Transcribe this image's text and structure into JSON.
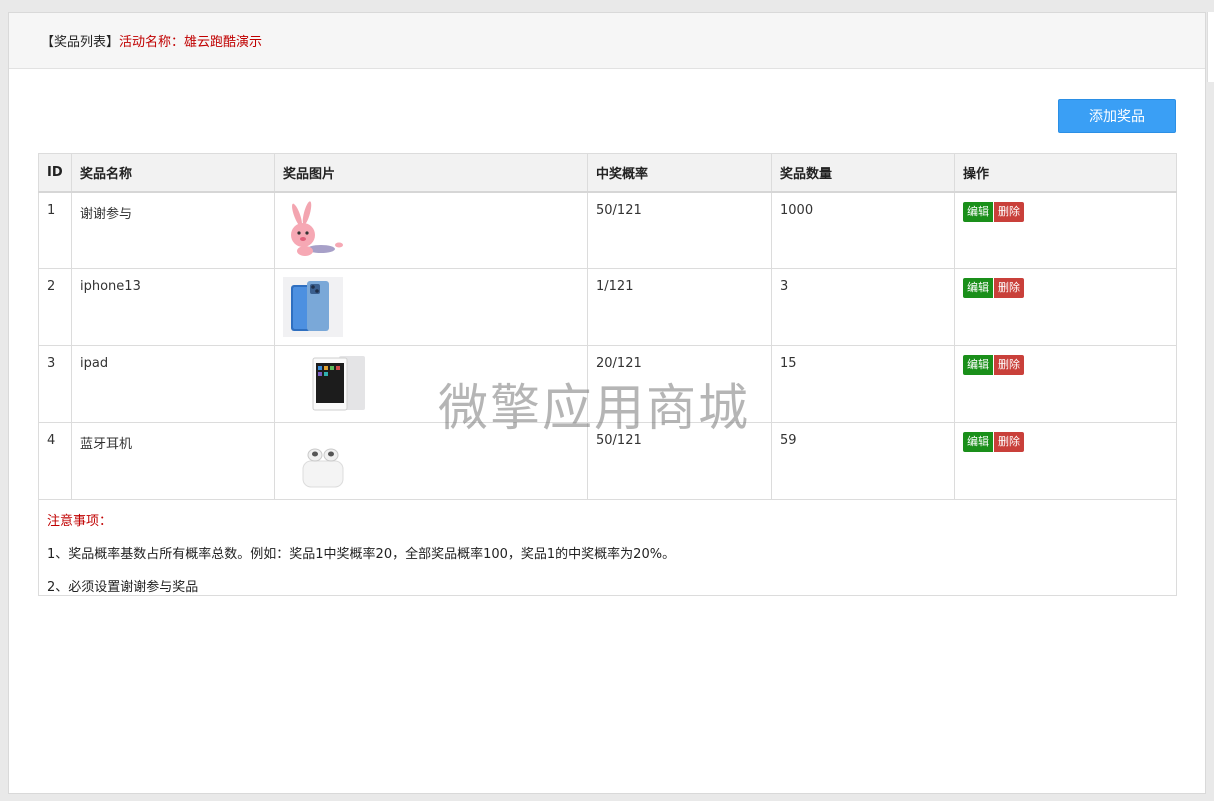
{
  "header": {
    "bracket_title": "【奖品列表】",
    "activity_label": "活动名称：雄云跑酷演示"
  },
  "toolbar": {
    "add_label": "添加奖品"
  },
  "table": {
    "columns": [
      "ID",
      "奖品名称",
      "奖品图片",
      "中奖概率",
      "奖品数量",
      "操作"
    ],
    "rows": [
      {
        "id": "1",
        "name": "谢谢参与",
        "image": "rabbit-image",
        "probability": "50/121",
        "quantity": "1000"
      },
      {
        "id": "2",
        "name": "iphone13",
        "image": "iphone-image",
        "probability": "1/121",
        "quantity": "3"
      },
      {
        "id": "3",
        "name": "ipad",
        "image": "ipad-image",
        "probability": "20/121",
        "quantity": "15"
      },
      {
        "id": "4",
        "name": "蓝牙耳机",
        "image": "earbuds-image",
        "probability": "50/121",
        "quantity": "59"
      }
    ],
    "edit_label": "编辑",
    "delete_label": "删除"
  },
  "notes": {
    "title": "注意事项：",
    "lines": [
      "1、奖品概率基数占所有概率总数。例如：奖品1中奖概率20，全部奖品概率100，奖品1的中奖概率为20%。",
      "2、必须设置谢谢参与奖品"
    ]
  },
  "watermark": "微擎应用商城",
  "colors": {
    "accent": "#3a9ff5",
    "edit": "#1a8f1a",
    "delete": "#c9403a",
    "highlight": "#c00000"
  }
}
